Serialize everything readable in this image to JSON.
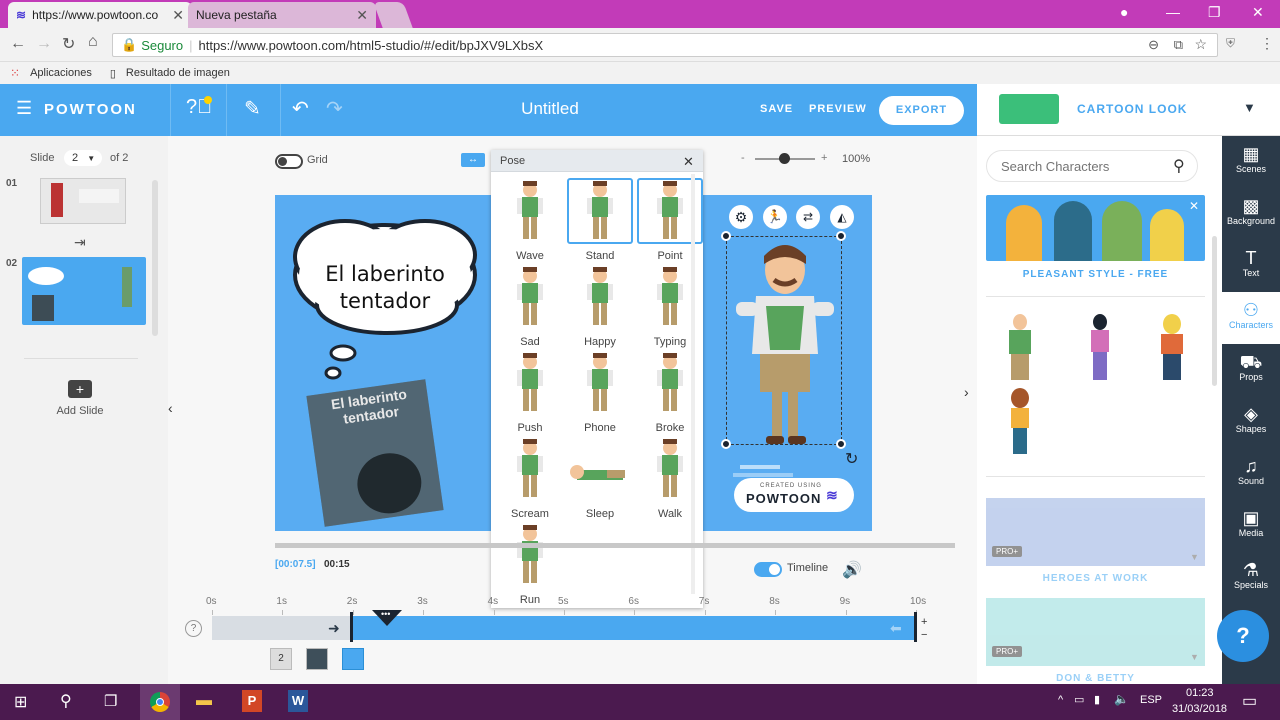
{
  "browser": {
    "tabs": [
      {
        "label": "https://www.powtoon.co"
      },
      {
        "label": "Nueva pestaña"
      }
    ],
    "secure_label": "Seguro",
    "url": "https://www.powtoon.com/html5-studio/#/edit/bpJXV9LXbsX",
    "bookmarks": [
      "Aplicaciones",
      "Resultado de imagen"
    ]
  },
  "header": {
    "logo": "POWTOON",
    "title": "Untitled",
    "save_label": "SAVE",
    "preview_label": "PREVIEW",
    "export_label": "EXPORT",
    "style_label": "CARTOON LOOK"
  },
  "slides": {
    "label": "Slide",
    "current": "2",
    "of_label": "of 2",
    "items": [
      {
        "num": "01"
      },
      {
        "num": "02"
      }
    ],
    "add_label": "Add Slide"
  },
  "stage": {
    "grid_label": "Grid",
    "zoom": "100%",
    "time_current": "[00:07.5]",
    "time_total": "00:15",
    "timeline_label": "Timeline",
    "speech_text": "El laberinto tentador",
    "book_title": "El laberinto tentador",
    "created_using": "CREATED USING",
    "created_brand": "POWTOON",
    "ruler": [
      "0s",
      "1s",
      "2s",
      "3s",
      "4s",
      "5s",
      "6s",
      "7s",
      "8s",
      "9s",
      "10s"
    ],
    "layer_badge": "2"
  },
  "pose_panel": {
    "title": "Pose",
    "poses": [
      "Wave",
      "Stand",
      "Point",
      "Sad",
      "Happy",
      "Typing",
      "Push",
      "Phone",
      "Broke",
      "Scream",
      "Sleep",
      "Walk",
      "Run"
    ]
  },
  "right_panel": {
    "search_placeholder": "Search Characters",
    "pleasant": "PLEASANT STYLE - FREE",
    "heroes": "HEROES AT WORK",
    "don": "DON & BETTY",
    "pro_badge": "PRO+"
  },
  "toolbar": {
    "items": [
      "Scenes",
      "Background",
      "Text",
      "Characters",
      "Props",
      "Shapes",
      "Sound",
      "Media",
      "Specials"
    ]
  },
  "taskbar": {
    "lang": "ESP",
    "time": "01:23",
    "date": "31/03/2018"
  },
  "colors": {
    "accent": "#4aa8f0",
    "canvas": "#59acf2",
    "toolbar": "#2b3a49"
  }
}
